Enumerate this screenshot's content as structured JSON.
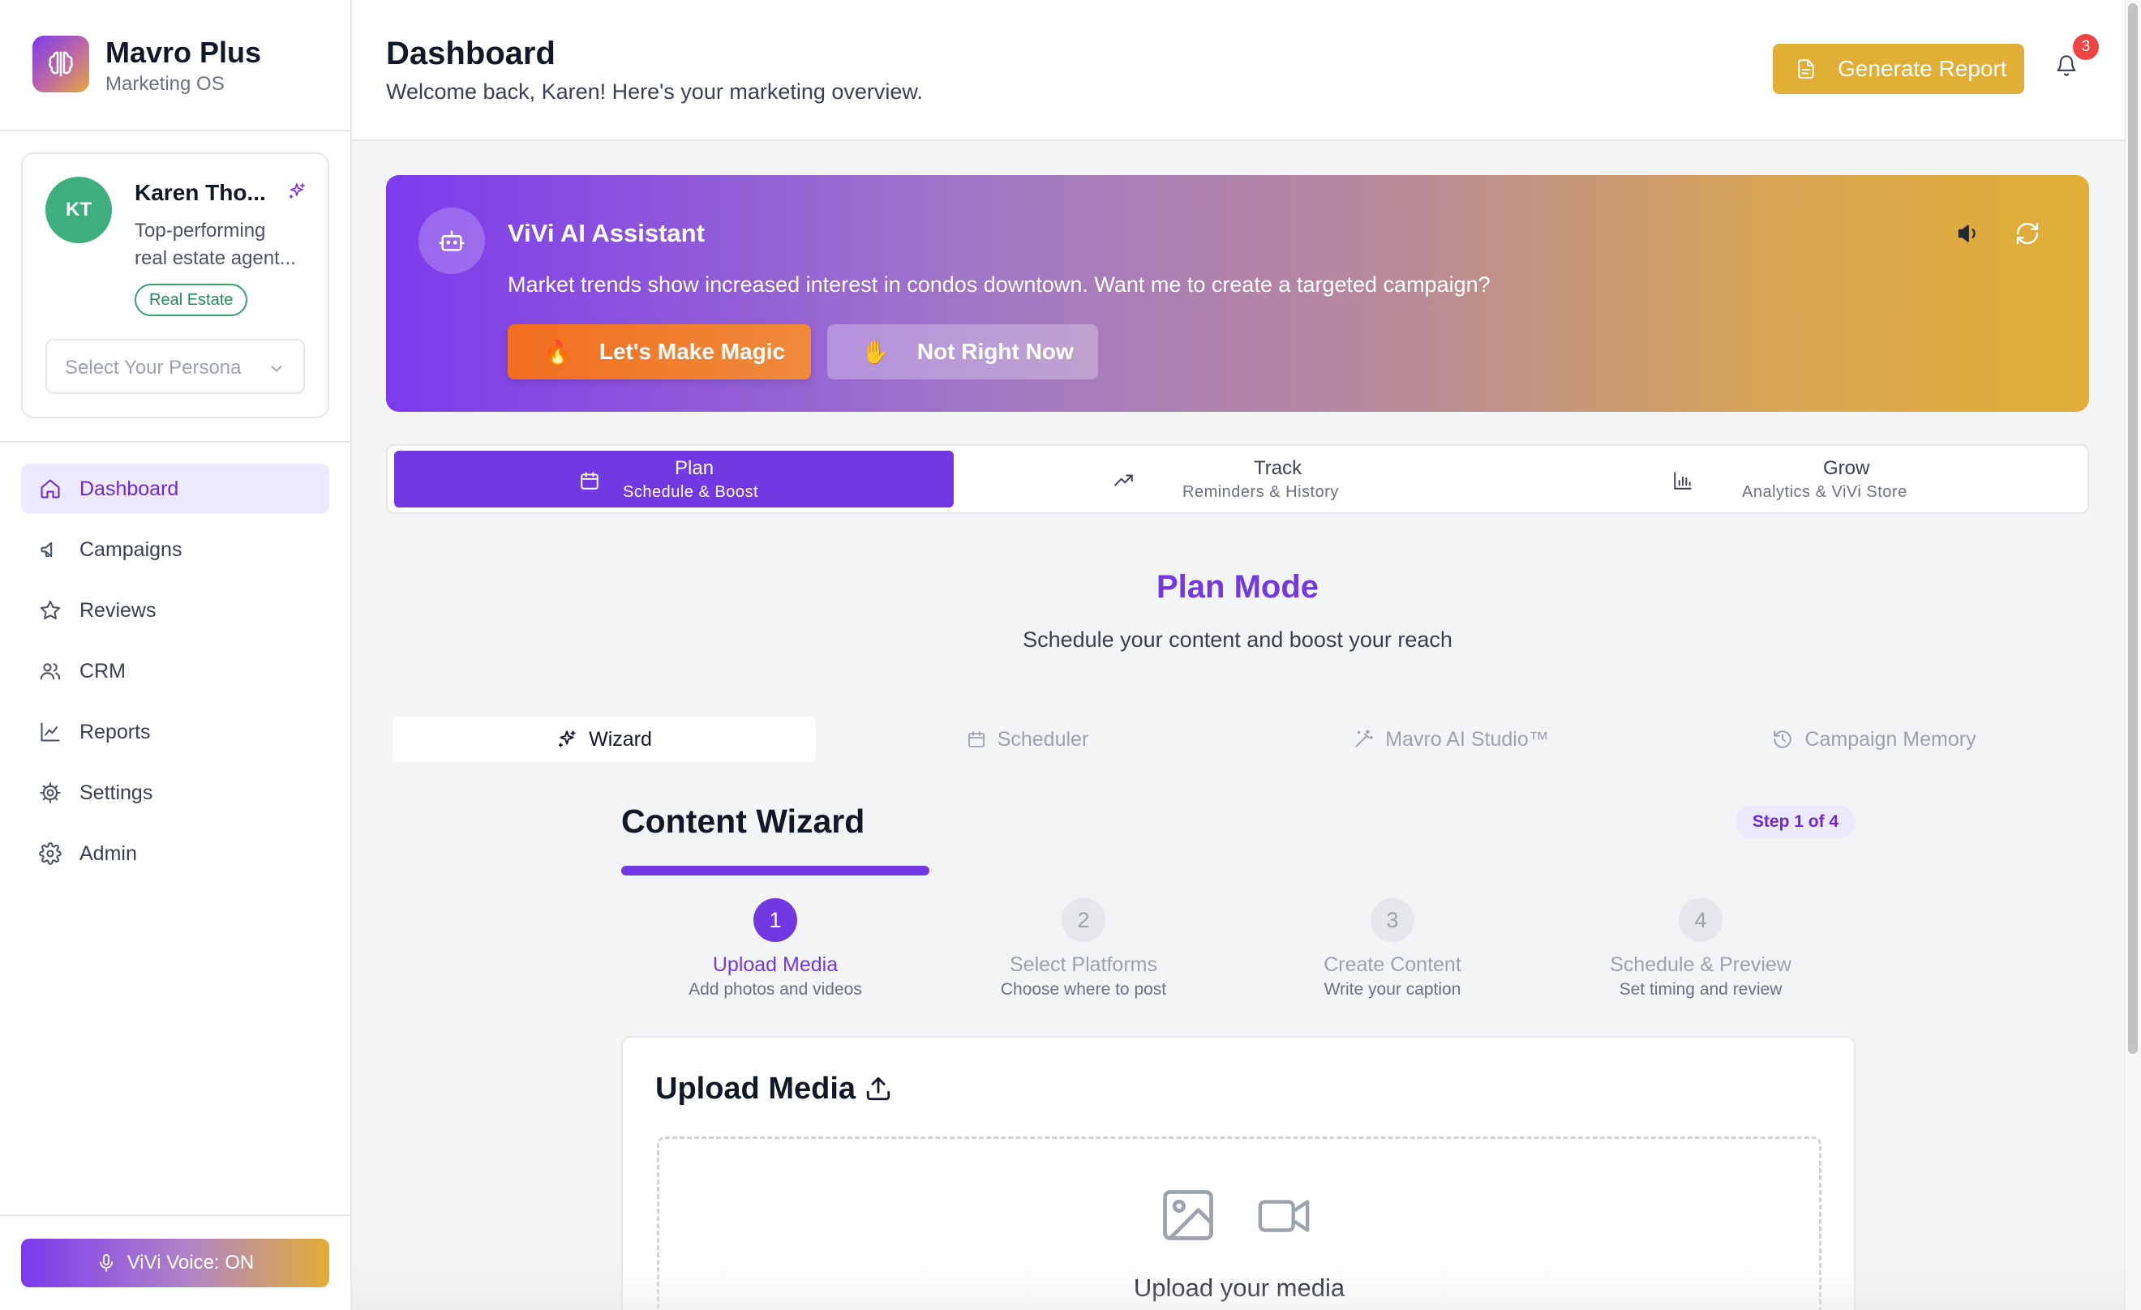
{
  "brand": {
    "name": "Mavro Plus",
    "tagline": "Marketing OS",
    "icon": "brain-icon"
  },
  "profile": {
    "initials": "KT",
    "name": "Karen Tho...",
    "description_line1": "Top-performing",
    "description_line2": "real estate agent...",
    "badge": "Real Estate",
    "persona_placeholder": "Select Your Persona"
  },
  "nav": {
    "items": [
      {
        "label": "Dashboard",
        "icon": "home-icon",
        "active": true
      },
      {
        "label": "Campaigns",
        "icon": "megaphone-icon",
        "active": false
      },
      {
        "label": "Reviews",
        "icon": "star-icon",
        "active": false
      },
      {
        "label": "CRM",
        "icon": "users-icon",
        "active": false
      },
      {
        "label": "Reports",
        "icon": "line-chart-icon",
        "active": false
      },
      {
        "label": "Settings",
        "icon": "cog-icon",
        "active": false
      },
      {
        "label": "Admin",
        "icon": "gear-icon",
        "active": false
      }
    ]
  },
  "voice": {
    "label": "ViVi Voice: ON"
  },
  "header": {
    "title": "Dashboard",
    "subtitle": "Welcome back, Karen! Here's your marketing overview.",
    "generate_label": "Generate Report",
    "notification_count": "3"
  },
  "vivi": {
    "title": "ViVi AI Assistant",
    "message": "Market trends show increased interest in condos downtown. Want me to create a targeted campaign?",
    "primary_emoji": "🔥",
    "primary_label": "Let's Make Magic",
    "secondary_emoji": "✋",
    "secondary_label": "Not Right Now"
  },
  "mode_tabs": [
    {
      "title": "Plan",
      "subtitle": "Schedule & Boost",
      "icon": "calendar-icon",
      "active": true
    },
    {
      "title": "Track",
      "subtitle": "Reminders & History",
      "icon": "trending-up-icon",
      "active": false
    },
    {
      "title": "Grow",
      "subtitle": "Analytics & ViVi Store",
      "icon": "bar-chart-icon",
      "active": false
    }
  ],
  "plan": {
    "title": "Plan Mode",
    "subtitle": "Schedule your content and boost your reach"
  },
  "sub_tabs": [
    {
      "label": "Wizard",
      "icon": "sparkles-icon",
      "active": true
    },
    {
      "label": "Scheduler",
      "icon": "calendar-icon",
      "active": false
    },
    {
      "label": "Mavro AI Studio™",
      "icon": "magic-wand-icon",
      "active": false
    },
    {
      "label": "Campaign Memory",
      "icon": "history-icon",
      "active": false
    }
  ],
  "wizard": {
    "title": "Content Wizard",
    "step_indicator": "Step 1 of 4",
    "progress": 0.25,
    "steps": [
      {
        "num": "1",
        "title": "Upload Media",
        "subtitle": "Add photos and videos",
        "active": true
      },
      {
        "num": "2",
        "title": "Select Platforms",
        "subtitle": "Choose where to post",
        "active": false
      },
      {
        "num": "3",
        "title": "Create Content",
        "subtitle": "Write your caption",
        "active": false
      },
      {
        "num": "4",
        "title": "Schedule & Preview",
        "subtitle": "Set timing and review",
        "active": false
      }
    ]
  },
  "upload": {
    "title": "Upload Media",
    "dropzone_text": "Upload your media"
  },
  "colors": {
    "accent": "#7138e3",
    "gold": "#e2ae35",
    "orange": "#f26e1f",
    "green": "#3fae7e"
  }
}
